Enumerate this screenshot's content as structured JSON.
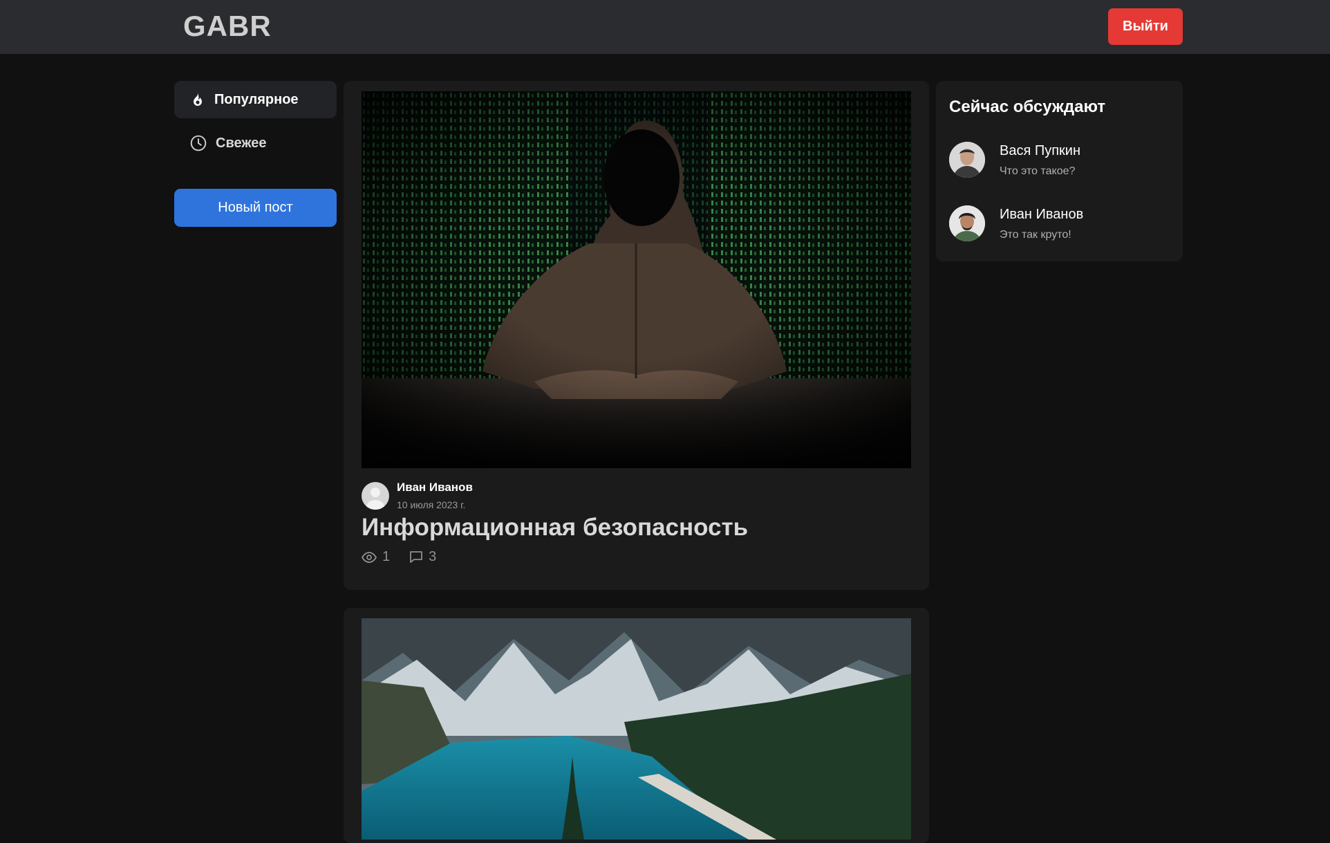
{
  "header": {
    "logo": "GABR",
    "logout_label": "Выйти"
  },
  "sidebar": {
    "items": [
      {
        "label": "Популярное",
        "icon": "fire-icon",
        "active": true
      },
      {
        "label": "Свежее",
        "icon": "clock-icon",
        "active": false
      }
    ],
    "new_post_label": "Новый пост"
  },
  "posts": [
    {
      "author": "Иван Иванов",
      "date": "10 июля 2023 г.",
      "title": "Информационная безопасность",
      "views": "1",
      "comments": "3",
      "image": "hooded-hacker-image"
    },
    {
      "image": "mountain-lake-image"
    }
  ],
  "discussion": {
    "title": "Сейчас обсуждают",
    "items": [
      {
        "name": "Вася Пупкин",
        "text": "Что это такое?"
      },
      {
        "name": "Иван Иванов",
        "text": "Это так круто!"
      }
    ]
  },
  "colors": {
    "background": "#111111",
    "topbar": "#2b2c2f",
    "card": "#1b1b1c",
    "logout": "#e53935",
    "primary": "#2f74dd"
  }
}
